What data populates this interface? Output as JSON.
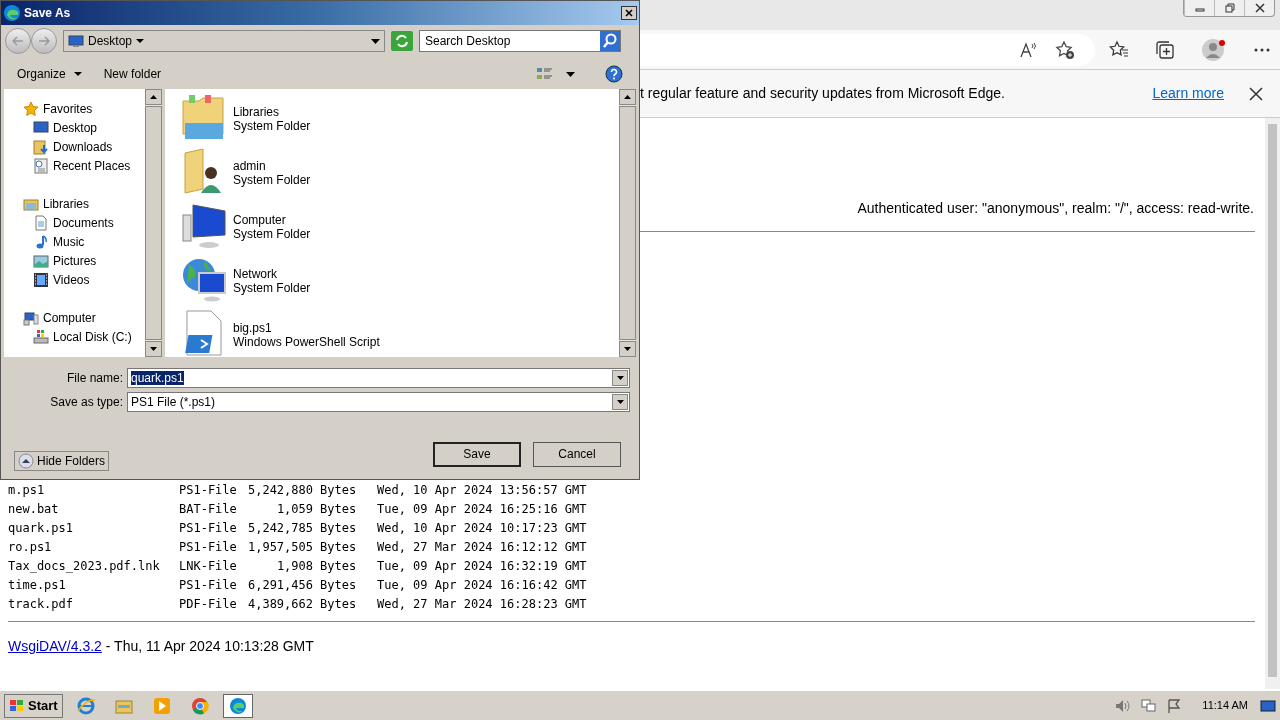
{
  "browser": {
    "infobar": {
      "text": "t regular feature and security updates from Microsoft Edge.",
      "link": "Learn more"
    }
  },
  "page": {
    "auth": "Authenticated user: \"anonymous\", realm: \"/\", access: read-write.",
    "files": [
      {
        "name": "m.ps1",
        "type": "PS1-File",
        "size": "5,242,880",
        "unit": "Bytes",
        "date": "Wed, 10 Apr 2024 13:56:57 GMT"
      },
      {
        "name": "new.bat",
        "type": "BAT-File",
        "size": "1,059",
        "unit": "Bytes",
        "date": "Tue, 09 Apr 2024 16:25:16 GMT"
      },
      {
        "name": "quark.ps1",
        "type": "PS1-File",
        "size": "5,242,785",
        "unit": "Bytes",
        "date": "Wed, 10 Apr 2024 10:17:23 GMT"
      },
      {
        "name": "ro.ps1",
        "type": "PS1-File",
        "size": "1,957,505",
        "unit": "Bytes",
        "date": "Wed, 27 Mar 2024 16:12:12 GMT"
      },
      {
        "name": "Tax_docs_2023.pdf.lnk",
        "type": "LNK-File",
        "size": "1,908",
        "unit": "Bytes",
        "date": "Tue, 09 Apr 2024 16:32:19 GMT"
      },
      {
        "name": "time.ps1",
        "type": "PS1-File",
        "size": "6,291,456",
        "unit": "Bytes",
        "date": "Tue, 09 Apr 2024 16:16:42 GMT"
      },
      {
        "name": "track.pdf",
        "type": "PDF-File",
        "size": "4,389,662",
        "unit": "Bytes",
        "date": "Wed, 27 Mar 2024 16:28:23 GMT"
      }
    ],
    "footer_link": "WsgiDAV/4.3.2",
    "footer_text": "- Thu, 11 Apr 2024 10:13:28 GMT"
  },
  "dialog": {
    "title": "Save As",
    "location": "Desktop",
    "search": {
      "placeholder": "Search Desktop"
    },
    "toolbar": [
      "Organize",
      "New folder"
    ],
    "nav_tree": [
      {
        "label": "Favorites",
        "children": [
          {
            "label": "Desktop"
          },
          {
            "label": "Downloads"
          },
          {
            "label": "Recent Places"
          }
        ]
      },
      {
        "label": "Libraries",
        "children": [
          {
            "label": "Documents"
          },
          {
            "label": "Music"
          },
          {
            "label": "Pictures"
          },
          {
            "label": "Videos"
          }
        ]
      },
      {
        "label": "Computer",
        "children": [
          {
            "label": "Local Disk (C:)"
          }
        ]
      }
    ],
    "items": [
      {
        "name": "Libraries",
        "type": "System Folder"
      },
      {
        "name": "admin",
        "type": "System Folder"
      },
      {
        "name": "Computer",
        "type": "System Folder"
      },
      {
        "name": "Network",
        "type": "System Folder"
      },
      {
        "name": "big.ps1",
        "type": "Windows PowerShell Script"
      }
    ],
    "file_name": {
      "label": "File name:",
      "value": "quark.ps1",
      "text_selected": true
    },
    "save_type": {
      "label": "Save as type:",
      "value": "PS1 File (*.ps1)"
    },
    "hide_folders": "Hide Folders",
    "buttons": [
      "Save",
      "Cancel"
    ]
  },
  "taskbar": {
    "start": "Start",
    "clock": "11:14 AM"
  }
}
